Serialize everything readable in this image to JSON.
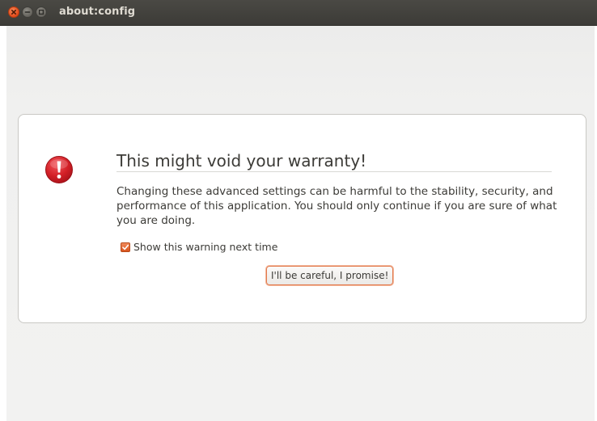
{
  "window": {
    "title": "about:config"
  },
  "warning": {
    "heading": "This might void your warranty!",
    "message": "Changing these advanced settings can be harmful to the stability, security, and performance of this application. You should only continue if you are sure of what you are doing.",
    "checkbox_label": "Show this warning next time",
    "checkbox_checked": true,
    "button_label": "I'll be careful, I promise!",
    "icon": "exclamation-icon"
  },
  "colors": {
    "titlebar": "#3c3b37",
    "accent": "#dd4814",
    "warning_icon": "#d21f26"
  }
}
